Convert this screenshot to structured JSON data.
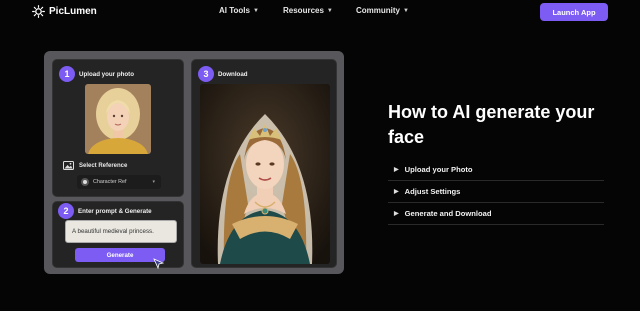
{
  "brand": {
    "name": "PicLumen"
  },
  "nav": {
    "items": [
      {
        "label": "AI Tools"
      },
      {
        "label": "Resources"
      },
      {
        "label": "Community"
      }
    ],
    "launch_label": "Launch App"
  },
  "demo": {
    "step1": {
      "number": "1",
      "title": "Upload your photo"
    },
    "reference": {
      "label": "Select Reference",
      "selected": "Character Ref"
    },
    "step2": {
      "number": "2",
      "title": "Enter prompt & Generate"
    },
    "prompt_value": "A beautiful medieval princess.",
    "generate_label": "Generate",
    "step3": {
      "number": "3",
      "title": "Download"
    }
  },
  "content": {
    "headline": "How to AI generate your face",
    "accordion": [
      {
        "label": "Upload your Photo"
      },
      {
        "label": "Adjust Settings"
      },
      {
        "label": "Generate and Download"
      }
    ]
  },
  "colors": {
    "accent": "#7c5cf2",
    "background": "#050505",
    "panel": "#58585c",
    "card": "#242424"
  }
}
